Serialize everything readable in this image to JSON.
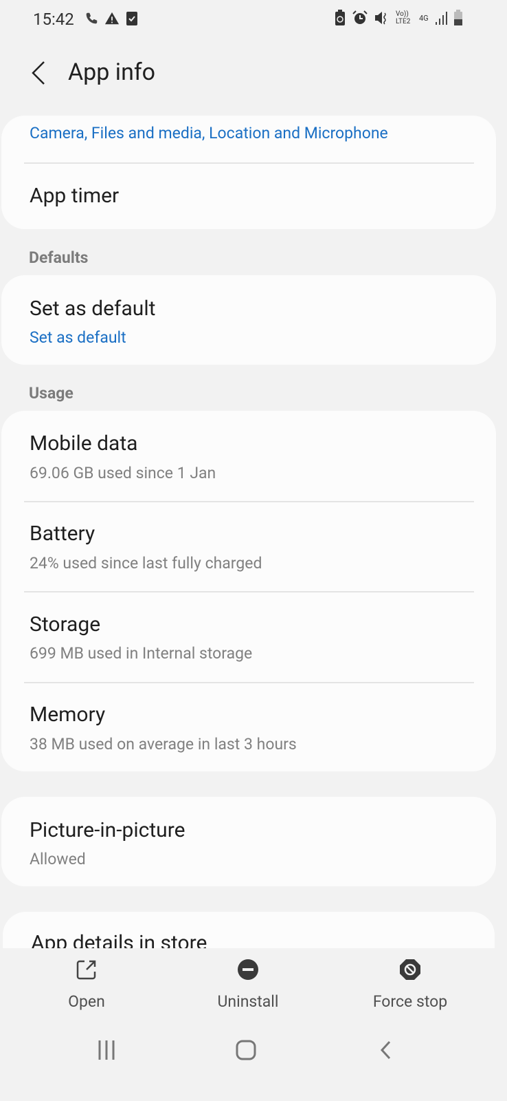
{
  "status_bar": {
    "time": "15:42",
    "left_icons": [
      "phone-icon",
      "warning-icon",
      "checkbox-icon"
    ],
    "right_icons": [
      "battery-saver-icon",
      "alarm-icon",
      "mute-icon",
      "volte-icon",
      "4g-icon",
      "signal-icon",
      "battery-icon"
    ],
    "volte_text": "Vo)) LTE2",
    "network_text": "4G"
  },
  "header": {
    "title": "App info"
  },
  "permissions": {
    "summary": "Camera, Files and media, Location and Microphone",
    "app_timer": "App timer"
  },
  "defaults": {
    "section": "Defaults",
    "title": "Set as default",
    "value": "Set as default"
  },
  "usage": {
    "section": "Usage",
    "items": [
      {
        "title": "Mobile data",
        "sub": "69.06 GB used since 1 Jan"
      },
      {
        "title": "Battery",
        "sub": "24% used since last fully charged"
      },
      {
        "title": "Storage",
        "sub": "699 MB used in Internal storage"
      },
      {
        "title": "Memory",
        "sub": "38 MB used on average in last 3 hours"
      }
    ]
  },
  "pip": {
    "title": "Picture-in-picture",
    "sub": "Allowed"
  },
  "store": {
    "title": "App details in store"
  },
  "actions": {
    "open": "Open",
    "uninstall": "Uninstall",
    "force_stop": "Force stop"
  },
  "colors": {
    "accent": "#1a6fc4",
    "background": "#f2f2f2",
    "card": "#fcfcfc"
  }
}
